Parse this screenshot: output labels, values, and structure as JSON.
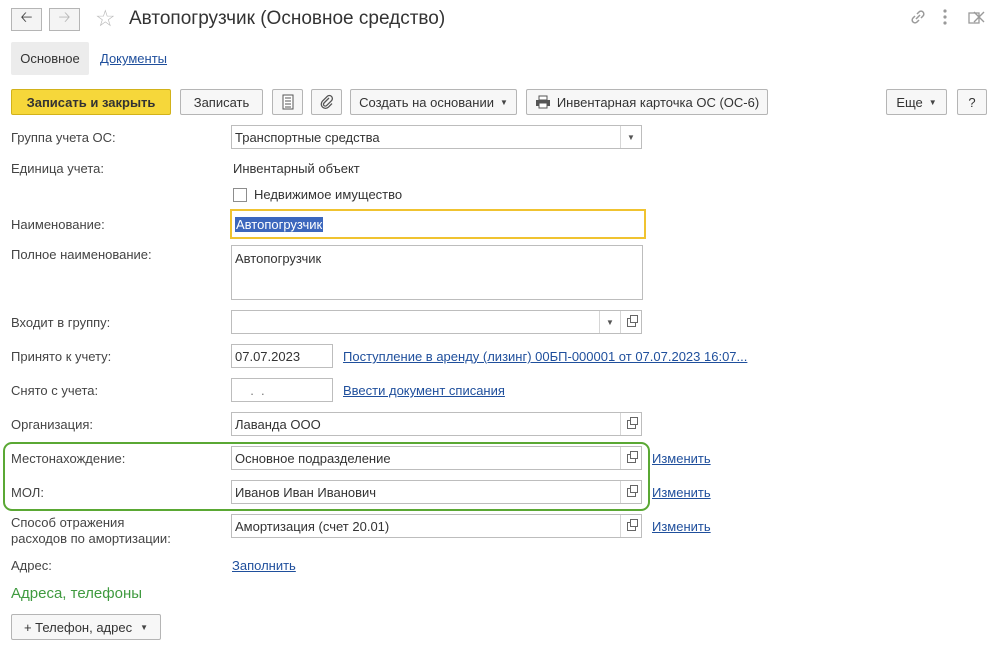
{
  "window": {
    "title": "Автопогрузчик (Основное средство)",
    "nav": {
      "back_icon": "arrow-left-icon",
      "forward_icon": "arrow-right-icon"
    },
    "icons": {
      "link": "link-icon",
      "menu": "more-vertical-icon",
      "maximize": "maximize-icon",
      "close": "close-icon",
      "favorite": "star-icon"
    }
  },
  "tabs": [
    {
      "label": "Основное",
      "active": true
    },
    {
      "label": "Документы",
      "active": false
    }
  ],
  "toolbar": {
    "save_close": "Записать и закрыть",
    "save": "Записать",
    "create_based": "Создать на основании",
    "inventory_card": "Инвентарная карточка ОС (ОС-6)",
    "more": "Еще",
    "help": "?"
  },
  "form": {
    "group": {
      "label": "Группа учета ОС:",
      "value": "Транспортные средства"
    },
    "unit": {
      "label": "Единица учета:",
      "value": "Инвентарный объект"
    },
    "immovable": {
      "label": "Недвижимое имущество",
      "checked": false
    },
    "name": {
      "label": "Наименование:",
      "value": "Автопогрузчик"
    },
    "full_name": {
      "label": "Полное наименование:",
      "value": "Автопогрузчик"
    },
    "parent_group": {
      "label": "Входит в группу:",
      "value": ""
    },
    "accepted": {
      "label": "Принято к учету:",
      "date": "07.07.2023",
      "link": "Поступление в аренду (лизинг) 00БП-000001 от 07.07.2023 16:07..."
    },
    "removed": {
      "label": "Снято с учета:",
      "date": "  .  .",
      "link": "Ввести документ списания"
    },
    "organization": {
      "label": "Организация:",
      "value": "Лаванда ООО"
    },
    "location": {
      "label": "Местонахождение:",
      "value": "Основное подразделение",
      "action": "Изменить"
    },
    "mol": {
      "label": "МОЛ:",
      "value": "Иванов Иван Иванович",
      "action": "Изменить"
    },
    "depreciation": {
      "label_line1": "Способ отражения",
      "label_line2": "расходов по амортизации:",
      "value": "Амортизация (счет 20.01)",
      "action": "Изменить"
    },
    "address": {
      "label": "Адрес:",
      "action": "Заполнить"
    }
  },
  "contacts": {
    "title": "Адреса, телефоны",
    "add_button": "+ Телефон, адрес"
  },
  "colors": {
    "primary_button": "#f6d73a",
    "highlight": "#5aa834",
    "link": "#1f4f9c",
    "focus": "#f0c330",
    "section_title": "#3f9a3f"
  }
}
